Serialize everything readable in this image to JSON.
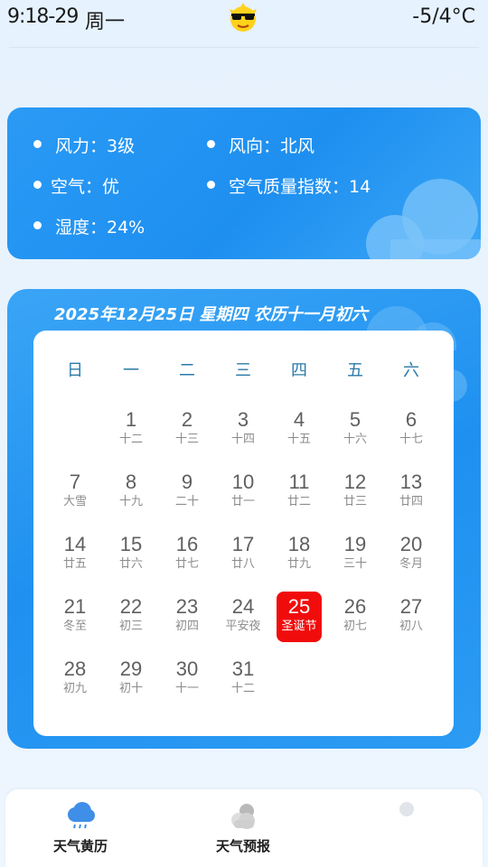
{
  "status_bar": {
    "time": "9:18-29",
    "weekday": "周一",
    "temperature": "-5/4°C"
  },
  "info": {
    "wind_force": "风力：3级",
    "wind_direction": "风向：北风",
    "air": "空气：优",
    "aqi": "空气质量指数：14",
    "humidity": "湿度：24%"
  },
  "calendar": {
    "title": "2025年12月25日 星期四 农历十一月初六",
    "weekdays": [
      "日",
      "一",
      "二",
      "三",
      "四",
      "五",
      "六"
    ],
    "days": [
      {
        "d": "1",
        "l": "十二"
      },
      {
        "d": "2",
        "l": "十三"
      },
      {
        "d": "3",
        "l": "十四"
      },
      {
        "d": "4",
        "l": "十五"
      },
      {
        "d": "5",
        "l": "十六"
      },
      {
        "d": "6",
        "l": "十七"
      },
      {
        "d": "7",
        "l": "大雪"
      },
      {
        "d": "8",
        "l": "十九"
      },
      {
        "d": "9",
        "l": "二十"
      },
      {
        "d": "10",
        "l": "廿一"
      },
      {
        "d": "11",
        "l": "廿二"
      },
      {
        "d": "12",
        "l": "廿三"
      },
      {
        "d": "13",
        "l": "廿四"
      },
      {
        "d": "14",
        "l": "廿五"
      },
      {
        "d": "15",
        "l": "廿六"
      },
      {
        "d": "16",
        "l": "廿七"
      },
      {
        "d": "17",
        "l": "廿八"
      },
      {
        "d": "18",
        "l": "廿九"
      },
      {
        "d": "19",
        "l": "三十"
      },
      {
        "d": "20",
        "l": "冬月"
      },
      {
        "d": "21",
        "l": "冬至"
      },
      {
        "d": "22",
        "l": "初三"
      },
      {
        "d": "23",
        "l": "初四"
      },
      {
        "d": "24",
        "l": "平安夜"
      },
      {
        "d": "25",
        "l": "圣诞节"
      },
      {
        "d": "26",
        "l": "初七"
      },
      {
        "d": "27",
        "l": "初八"
      },
      {
        "d": "28",
        "l": "初九"
      },
      {
        "d": "29",
        "l": "初十"
      },
      {
        "d": "30",
        "l": "十一"
      },
      {
        "d": "31",
        "l": "十二"
      }
    ],
    "selected_day": "25",
    "selected_color": "#f10c0c"
  },
  "nav": {
    "tab1": "天气黄历",
    "tab2": "天气预报",
    "tab1_icon": "rain-cloud-icon",
    "tab2_icon": "partly-cloudy-icon"
  }
}
